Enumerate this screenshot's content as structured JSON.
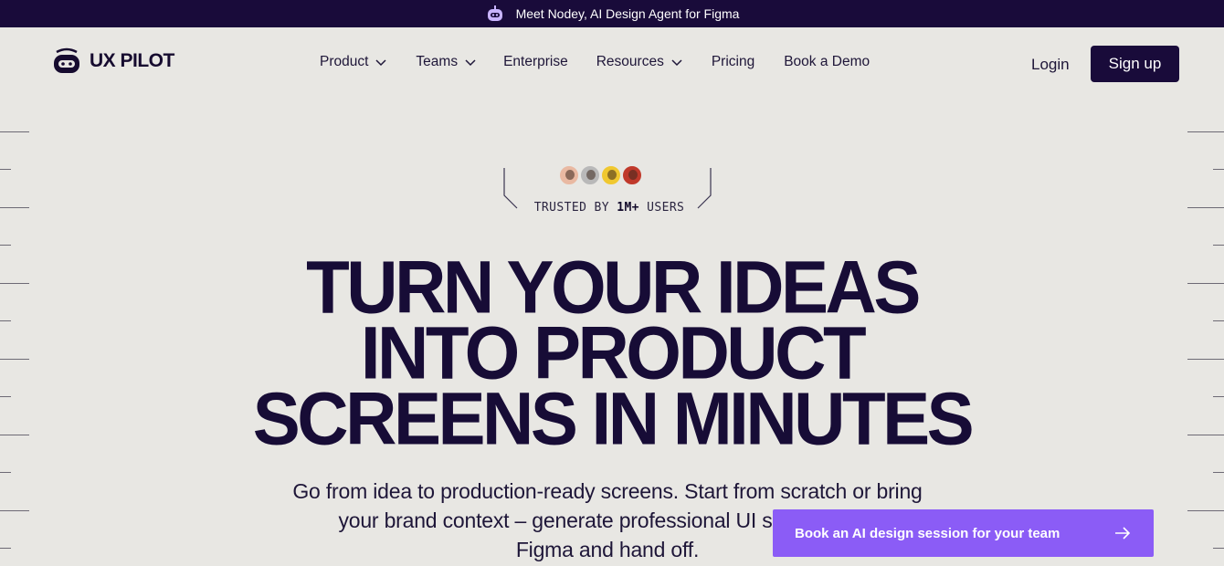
{
  "announcement": {
    "text": "Meet Nodey, AI Design Agent for Figma",
    "icon": "robot-icon"
  },
  "header": {
    "logo_text": "UX PILOT",
    "nav": [
      {
        "label": "Product",
        "has_dropdown": true
      },
      {
        "label": "Teams",
        "has_dropdown": true
      },
      {
        "label": "Enterprise",
        "has_dropdown": false
      },
      {
        "label": "Resources",
        "has_dropdown": true
      },
      {
        "label": "Pricing",
        "has_dropdown": false
      },
      {
        "label": "Book a Demo",
        "has_dropdown": false
      }
    ],
    "login_label": "Login",
    "signup_label": "Sign up"
  },
  "hero": {
    "trusted_prefix": "TRUSTED BY",
    "trusted_count": "1M+",
    "trusted_suffix": "USERS",
    "headline": [
      "TURN YOUR IDEAS",
      "INTO PRODUCT",
      "SCREENS IN MINUTES"
    ],
    "subtitle_lines": [
      "Go from idea to production-ready screens. Start from scratch or bring",
      "your brand context – generate professional UI scree",
      "Figma and hand off."
    ]
  },
  "cta": {
    "label": "Book an AI design session for your team",
    "icon": "arrow-right-icon"
  },
  "colors": {
    "background": "#e8e7e3",
    "dark": "#190b3a",
    "accent": "#8b5cf6"
  }
}
